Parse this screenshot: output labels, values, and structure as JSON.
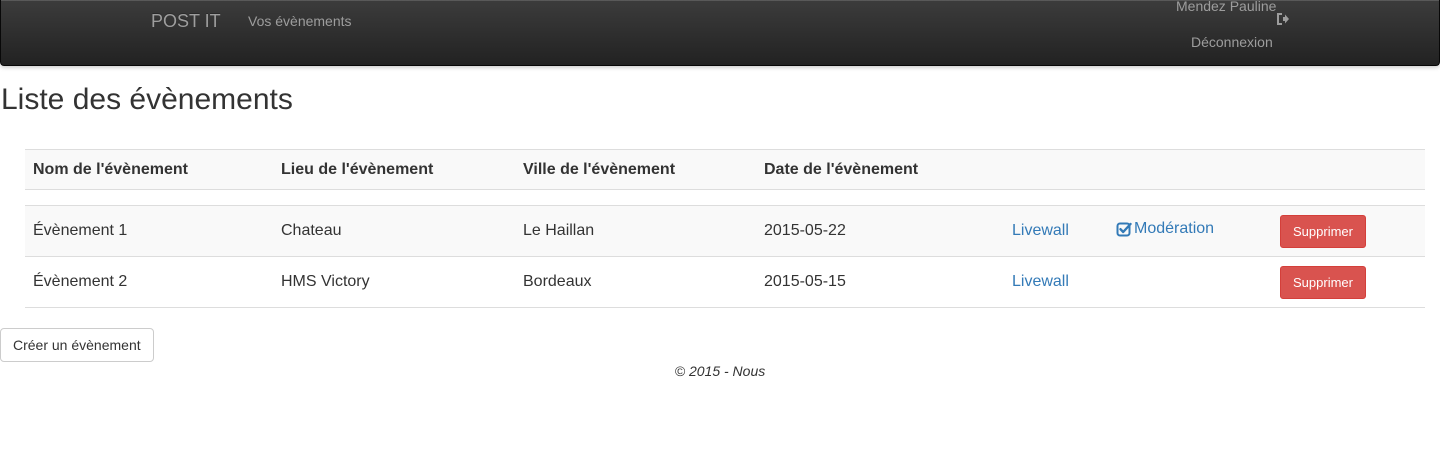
{
  "navbar": {
    "brand": "POST IT",
    "link_events": "Vos évènements",
    "user_name": "Mendez Pauline",
    "logout_label": "Déconnexion",
    "logout_icon": "log-out-icon"
  },
  "page": {
    "title": "Liste des évènements"
  },
  "table": {
    "headers": [
      "Nom de l'évènement",
      "Lieu de l'évènement",
      "Ville de l'évènement",
      "Date de l'évènement"
    ],
    "rows": [
      {
        "name": "Évènement 1",
        "place": "Chateau",
        "city": "Le Haillan",
        "date": "2015-05-22",
        "livewall": "Livewall",
        "moderation": "Modération",
        "delete": "Supprimer"
      },
      {
        "name": "Évènement 2",
        "place": "HMS Victory",
        "city": "Bordeaux",
        "date": "2015-05-15",
        "livewall": "Livewall",
        "delete": "Supprimer"
      }
    ]
  },
  "create_button": "Créer un évènement",
  "footer": "© 2015 - Nous",
  "colors": {
    "navbar": "#222222",
    "link": "#337ab7",
    "danger": "#d9534f",
    "stripe": "#f9f9f9"
  }
}
